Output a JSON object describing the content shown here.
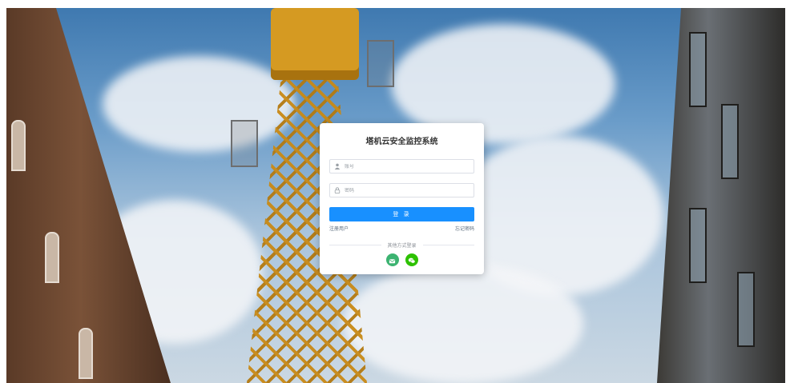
{
  "login": {
    "title": "塔机云安全监控系统",
    "username_placeholder": "账号",
    "password_placeholder": "密码",
    "submit_label": "登 录",
    "register_link": "注册用户",
    "forgot_link": "忘记密码",
    "other_login_label": "其他方式登录"
  },
  "social": [
    {
      "name": "email",
      "icon": "email-icon",
      "color": "#3cb371"
    },
    {
      "name": "wechat",
      "icon": "wechat-icon",
      "color": "#2dc100"
    }
  ],
  "colors": {
    "primary": "#1890ff",
    "card_bg": "#ffffff"
  },
  "background": {
    "description_icons": [
      "tower-crane",
      "brick-building",
      "glass-building",
      "cloudy-sky"
    ]
  }
}
